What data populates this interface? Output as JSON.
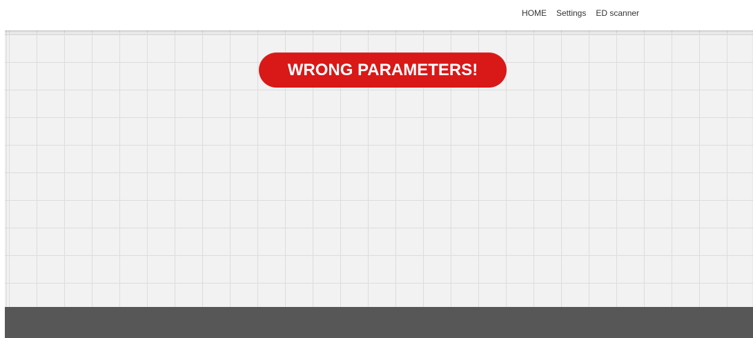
{
  "nav": {
    "items": [
      {
        "label": "HOME"
      },
      {
        "label": "Settings"
      },
      {
        "label": "ED scanner"
      }
    ]
  },
  "main": {
    "error_message": "WRONG PARAMETERS!"
  },
  "colors": {
    "error_background": "#d91818",
    "content_background": "#f2f2f2",
    "footer_background": "#575757"
  }
}
